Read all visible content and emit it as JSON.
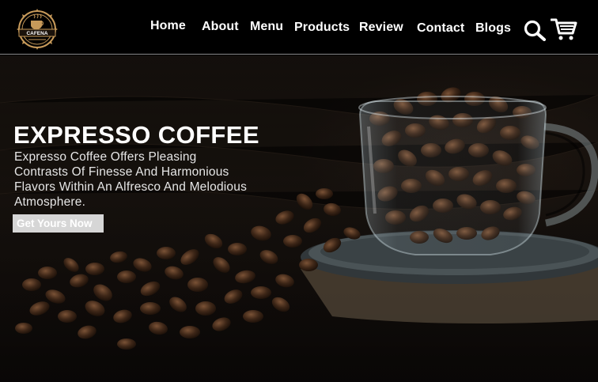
{
  "brand": {
    "logo_text": "CAFENA"
  },
  "nav": {
    "items": [
      {
        "label": "Home"
      },
      {
        "label": "About"
      },
      {
        "label": "Menu"
      },
      {
        "label": "Products"
      },
      {
        "label": "Review"
      },
      {
        "label": "Contact"
      },
      {
        "label": "Blogs"
      }
    ]
  },
  "icons": {
    "search": "search-icon",
    "cart": "cart-icon"
  },
  "hero": {
    "title": "EXPRESSO COFFEE",
    "description": "Expresso Coffee Offers Pleasing Contrasts Of Finesse And Harmonious Flavors Within An Alfresco And Melodious Atmosphere.",
    "cta_label": "Get Yours Now"
  },
  "colors": {
    "header_bg": "#000000",
    "cta_bg": "#d6d6d6",
    "text": "#ffffff"
  }
}
